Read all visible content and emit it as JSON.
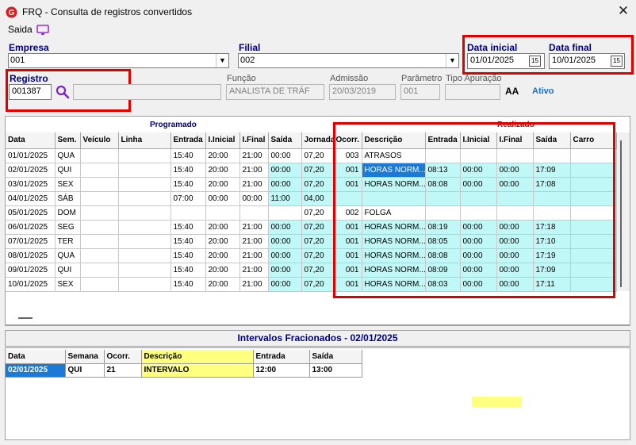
{
  "window": {
    "title": "FRQ - Consulta de registros convertidos",
    "close_glyph": "✕"
  },
  "menu": {
    "saida_label": "Saida"
  },
  "fields": {
    "empresa": {
      "label": "Empresa",
      "value": "001"
    },
    "filial": {
      "label": "Filial",
      "value": "002"
    },
    "data_inicial": {
      "label": "Data inicial",
      "value": "01/01/2025"
    },
    "data_final": {
      "label": "Data final",
      "value": "10/01/2025"
    },
    "registro": {
      "label": "Registro",
      "value": "001387",
      "name_value": ""
    },
    "funcao": {
      "label": "Função",
      "value": "ANALISTA DE TRÁF"
    },
    "admissao": {
      "label": "Admissão",
      "value": "20/03/2019"
    },
    "parametro": {
      "label": "Parâmetro",
      "value": "001"
    },
    "tipo_apuracao": {
      "label": "Tipo Apuração",
      "value": ""
    },
    "status": "Ativo",
    "font_size_glyph": "AA"
  },
  "grid": {
    "group_programado": "Programado",
    "group_realizado": "Realizado",
    "programado_columns": [
      "Data",
      "Sem.",
      "Veículo",
      "Linha",
      "Entrada",
      "I.Inicial",
      "I.Final",
      "Saída",
      "Jornada"
    ],
    "realizado_columns": [
      "Ocorr.",
      "Descrição",
      "Entrada",
      "I.Inicial",
      "I.Final",
      "Saída",
      "Carro"
    ],
    "rows": [
      {
        "prog": [
          "01/01/2025",
          "QUA",
          "",
          "",
          "15:40",
          "20:00",
          "21:00",
          "00:00",
          "07,20"
        ],
        "real": [
          "003",
          "ATRASOS",
          "",
          "",
          "",
          "",
          ""
        ]
      },
      {
        "prog": [
          "02/01/2025",
          "QUI",
          "",
          "",
          "15:40",
          "20:00",
          "21:00",
          "00:00",
          "07,20"
        ],
        "real": [
          "001",
          "HORAS NORM...",
          "08:13",
          "00:00",
          "00:00",
          "17:09",
          ""
        ]
      },
      {
        "prog": [
          "03/01/2025",
          "SEX",
          "",
          "",
          "15:40",
          "20:00",
          "21:00",
          "00:00",
          "07,20"
        ],
        "real": [
          "001",
          "HORAS NORM...",
          "08:08",
          "00:00",
          "00:00",
          "17:08",
          ""
        ]
      },
      {
        "prog": [
          "04/01/2025",
          "SÁB",
          "",
          "",
          "07:00",
          "00:00",
          "00:00",
          "11:00",
          "04,00"
        ],
        "real": [
          "",
          "",
          "",
          "",
          "",
          "",
          ""
        ]
      },
      {
        "prog": [
          "05/01/2025",
          "DOM",
          "",
          "",
          "",
          "",
          "",
          "",
          "07,20"
        ],
        "real": [
          "002",
          "FOLGA",
          "",
          "",
          "",
          "",
          ""
        ]
      },
      {
        "prog": [
          "06/01/2025",
          "SEG",
          "",
          "",
          "15:40",
          "20:00",
          "21:00",
          "00:00",
          "07,20"
        ],
        "real": [
          "001",
          "HORAS NORM...",
          "08:19",
          "00:00",
          "00:00",
          "17:18",
          ""
        ]
      },
      {
        "prog": [
          "07/01/2025",
          "TER",
          "",
          "",
          "15:40",
          "20:00",
          "21:00",
          "00:00",
          "07,20"
        ],
        "real": [
          "001",
          "HORAS NORM...",
          "08:05",
          "00:00",
          "00:00",
          "17:10",
          ""
        ]
      },
      {
        "prog": [
          "08/01/2025",
          "QUA",
          "",
          "",
          "15:40",
          "20:00",
          "21:00",
          "00:00",
          "07,20"
        ],
        "real": [
          "001",
          "HORAS NORM...",
          "08:08",
          "00:00",
          "00:00",
          "17:19",
          ""
        ]
      },
      {
        "prog": [
          "09/01/2025",
          "QUI",
          "",
          "",
          "15:40",
          "20:00",
          "21:00",
          "00:00",
          "07,20"
        ],
        "real": [
          "001",
          "HORAS NORM...",
          "08:09",
          "00:00",
          "00:00",
          "17:09",
          ""
        ]
      },
      {
        "prog": [
          "10/01/2025",
          "SEX",
          "",
          "",
          "15:40",
          "20:00",
          "21:00",
          "00:00",
          "07,20"
        ],
        "real": [
          "001",
          "HORAS NORM...",
          "08:03",
          "00:00",
          "00:00",
          "17:11",
          ""
        ]
      }
    ]
  },
  "intervalos": {
    "title": "Intervalos Fracionados - 02/01/2025",
    "columns": [
      "Data",
      "Semana",
      "Ocorr.",
      "Descrição",
      "Entrada",
      "Saída"
    ],
    "rows": [
      [
        "02/01/2025",
        "QUI",
        "21",
        "INTERVALO",
        "12:00",
        "13:00"
      ]
    ]
  },
  "colors": {
    "highlight_row": "#c0f8f8",
    "selection": "#1a7ad6",
    "annotation_red": "#e00000",
    "description_yellow": "#ffff80",
    "label_blue": "#00007a"
  }
}
